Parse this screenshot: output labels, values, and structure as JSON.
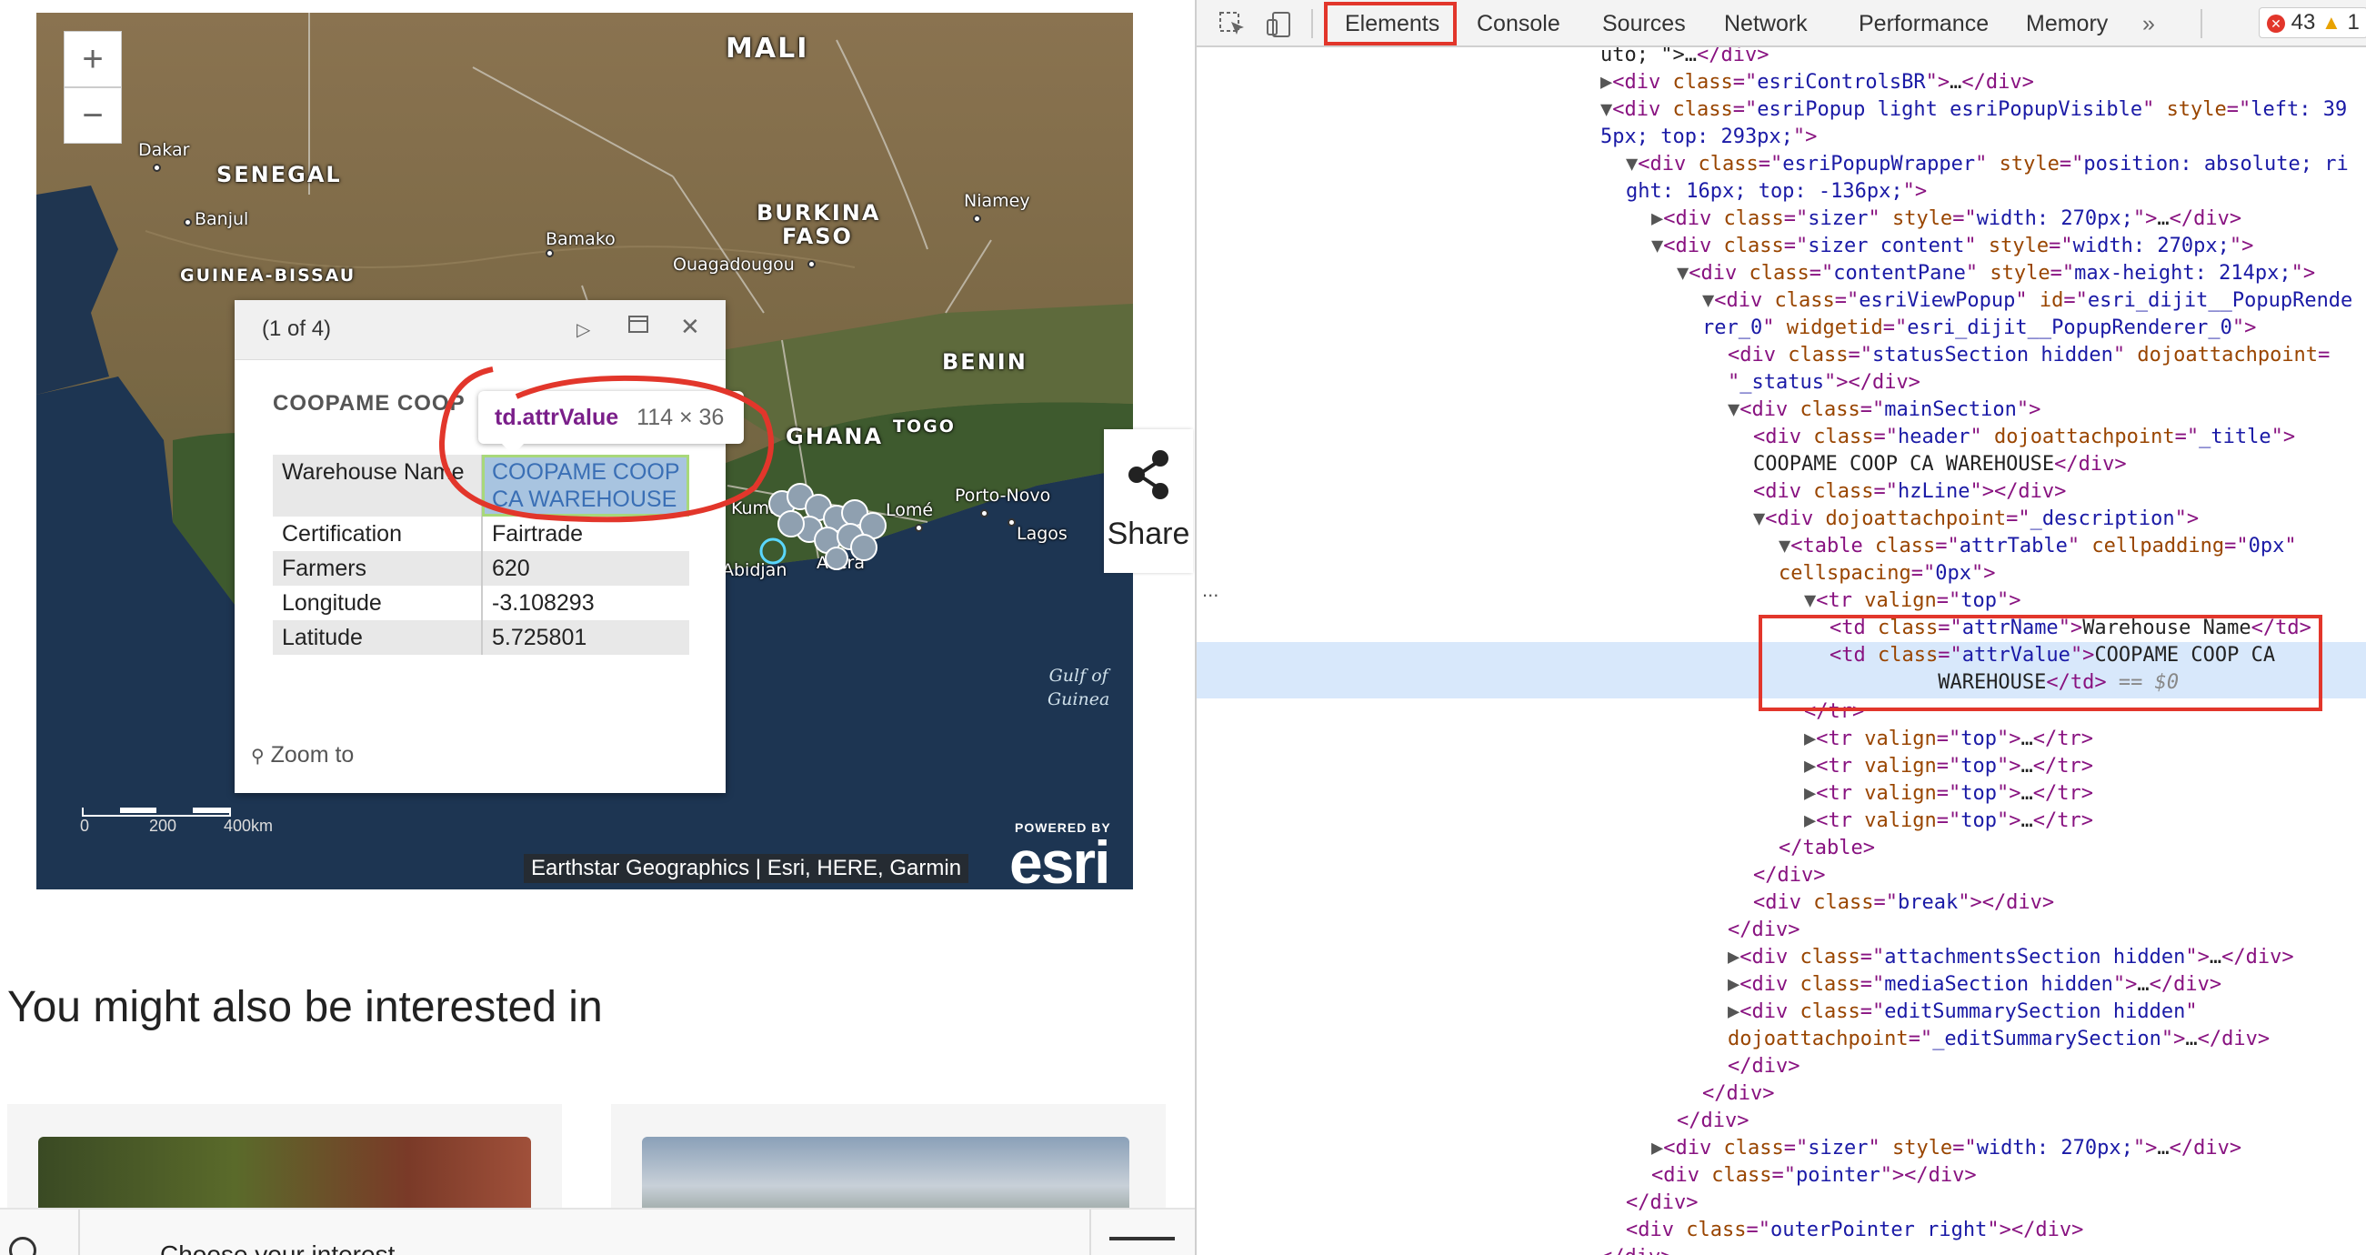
{
  "map": {
    "zoom_in": "+",
    "zoom_out": "−",
    "countries": [
      "MALI",
      "SENEGAL",
      "GUINEA-BISSAU",
      "BURKINA",
      "FASO",
      "BENIN",
      "GHANA",
      "TOGO"
    ],
    "cities": [
      "Dakar",
      "Banjul",
      "Bamako",
      "Niamey",
      "Ouagadougou",
      "Kumasi",
      "Abidjan",
      "Accra",
      "Lomé",
      "Porto-Novo",
      "Lagos"
    ],
    "gulf": [
      "Gulf of",
      "Guinea"
    ],
    "scale": [
      "0",
      "200",
      "400km"
    ],
    "attribution": "Earthstar Geographics | Esri, HERE, Garmin",
    "powered_by": "POWERED BY",
    "esri_logo": "esri"
  },
  "popup": {
    "count": "(1 of 4)",
    "title": "COOPAME COOP",
    "rows": [
      {
        "name": "Warehouse Name",
        "value": "COOPAME COOP CA WAREHOUSE"
      },
      {
        "name": "Certification",
        "value": "Fairtrade"
      },
      {
        "name": "Farmers",
        "value": "620"
      },
      {
        "name": "Longitude",
        "value": "-3.108293"
      },
      {
        "name": "Latitude",
        "value": "5.725801"
      }
    ],
    "zoom_to": "Zoom to"
  },
  "tooltip": {
    "name": "td.attrValue",
    "size": "114 × 36"
  },
  "share": {
    "label": "Share"
  },
  "interest": {
    "title": "You might also be interested in"
  },
  "bottombar": {
    "choose": "Choose your interest"
  },
  "devtools": {
    "tabs": [
      "Elements",
      "Console",
      "Sources",
      "Network",
      "Performance",
      "Memory",
      "»"
    ],
    "errors": "43",
    "warnings": "1",
    "ellipsis": "...",
    "lines": [
      {
        "indent": 0,
        "html": "<span class='tx'>uto; \">…</span><span class='tg'>&lt;/div&gt;</span>"
      },
      {
        "indent": 0,
        "html": "<span class='tri'>▶</span><span class='tg'>&lt;div </span><span class='at'>class</span><span class='tg'>=\"</span><span class='av'>esriControlsBR</span><span class='tg'>\"&gt;</span><span class='tx'>…</span><span class='tg'>&lt;/div&gt;</span>"
      },
      {
        "indent": 0,
        "html": "<span class='tri'>▼</span><span class='tg'>&lt;div </span><span class='at'>class</span><span class='tg'>=\"</span><span class='av'>esriPopup light esriPopupVisible</span><span class='tg'>\" </span><span class='at'>style</span><span class='tg'>=\"</span><span class='av'>left: 39</span>"
      },
      {
        "indent": 0,
        "html": "<span class='av'>5px; top: 293px;</span><span class='tg'>\"&gt;</span>"
      },
      {
        "indent": 1,
        "html": "<span class='tri'>▼</span><span class='tg'>&lt;div </span><span class='at'>class</span><span class='tg'>=\"</span><span class='av'>esriPopupWrapper</span><span class='tg'>\" </span><span class='at'>style</span><span class='tg'>=\"</span><span class='av'>position: absolute; ri</span>"
      },
      {
        "indent": 1,
        "html": "<span class='av'>ght: 16px; top: -136px;</span><span class='tg'>\"&gt;</span>"
      },
      {
        "indent": 2,
        "html": "<span class='tri'>▶</span><span class='tg'>&lt;div </span><span class='at'>class</span><span class='tg'>=\"</span><span class='av'>sizer</span><span class='tg'>\" </span><span class='at'>style</span><span class='tg'>=\"</span><span class='av'>width: 270px;</span><span class='tg'>\"&gt;</span><span class='tx'>…</span><span class='tg'>&lt;/div&gt;</span>"
      },
      {
        "indent": 2,
        "html": "<span class='tri'>▼</span><span class='tg'>&lt;div </span><span class='at'>class</span><span class='tg'>=\"</span><span class='av'>sizer content</span><span class='tg'>\" </span><span class='at'>style</span><span class='tg'>=\"</span><span class='av'>width: 270px;</span><span class='tg'>\"&gt;</span>"
      },
      {
        "indent": 3,
        "html": "<span class='tri'>▼</span><span class='tg'>&lt;div </span><span class='at'>class</span><span class='tg'>=\"</span><span class='av'>contentPane</span><span class='tg'>\" </span><span class='at'>style</span><span class='tg'>=\"</span><span class='av'>max-height: 214px;</span><span class='tg'>\"&gt;</span>"
      },
      {
        "indent": 4,
        "html": "<span class='tri'>▼</span><span class='tg'>&lt;div </span><span class='at'>class</span><span class='tg'>=\"</span><span class='av'>esriViewPopup</span><span class='tg'>\" </span><span class='at'>id</span><span class='tg'>=\"</span><span class='av'>esri_dijit__PopupRende</span>"
      },
      {
        "indent": 4,
        "html": "<span class='av'>rer_0</span><span class='tg'>\" </span><span class='at'>widgetid</span><span class='tg'>=\"</span><span class='av'>esri_dijit__PopupRenderer_0</span><span class='tg'>\"&gt;</span>"
      },
      {
        "indent": 5,
        "html": "<span class='tg'>&lt;div </span><span class='at'>class</span><span class='tg'>=\"</span><span class='av'>statusSection hidden</span><span class='tg'>\" </span><span class='at'>dojoattachpoint</span><span class='tg'>=</span>"
      },
      {
        "indent": 5,
        "html": "<span class='tg'>\"</span><span class='av'>_status</span><span class='tg'>\"&gt;&lt;/div&gt;</span>"
      },
      {
        "indent": 5,
        "html": "<span class='tri'>▼</span><span class='tg'>&lt;div </span><span class='at'>class</span><span class='tg'>=\"</span><span class='av'>mainSection</span><span class='tg'>\"&gt;</span>"
      },
      {
        "indent": 6,
        "html": "<span class='tg'>&lt;div </span><span class='at'>class</span><span class='tg'>=\"</span><span class='av'>header</span><span class='tg'>\" </span><span class='at'>dojoattachpoint</span><span class='tg'>=\"</span><span class='av'>_title</span><span class='tg'>\"&gt;</span>"
      },
      {
        "indent": 6,
        "html": "<span class='tx'>COOPAME COOP CA WAREHOUSE</span><span class='tg'>&lt;/div&gt;</span>"
      },
      {
        "indent": 6,
        "html": "<span class='tg'>&lt;div </span><span class='at'>class</span><span class='tg'>=\"</span><span class='av'>hzLine</span><span class='tg'>\"&gt;&lt;/div&gt;</span>"
      },
      {
        "indent": 6,
        "html": "<span class='tri'>▼</span><span class='tg'>&lt;div </span><span class='at'>dojoattachpoint</span><span class='tg'>=\"</span><span class='av'>_description</span><span class='tg'>\"&gt;</span>"
      },
      {
        "indent": 7,
        "html": "<span class='tri'>▼</span><span class='tg'>&lt;table </span><span class='at'>class</span><span class='tg'>=\"</span><span class='av'>attrTable</span><span class='tg'>\" </span><span class='at'>cellpadding</span><span class='tg'>=\"</span><span class='av'>0px</span><span class='tg'>\"</span>"
      },
      {
        "indent": 7,
        "html": "<span class='at'>cellspacing</span><span class='tg'>=\"</span><span class='av'>0px</span><span class='tg'>\"&gt;</span>"
      },
      {
        "indent": 8,
        "html": "<span class='tri'>▼</span><span class='tg'>&lt;tr </span><span class='at'>valign</span><span class='tg'>=\"</span><span class='av'>top</span><span class='tg'>\"&gt;</span>"
      },
      {
        "indent": 9,
        "html": "<span class='tg'>&lt;td </span><span class='at'>class</span><span class='tg'>=\"</span><span class='av'>attrName</span><span class='tg'>\"&gt;</span><span class='tx'>Warehouse Name</span><span class='tg'>&lt;/td&gt;</span>"
      },
      {
        "indent": 9,
        "sel": true,
        "html": "<span class='tg'>&lt;td </span><span class='at'>class</span><span class='tg'>=\"</span><span class='av'>attrValue</span><span class='tg'>\"&gt;</span><span class='tx'>COOPAME COOP CA</span>\n<span class='tx'>         WAREHOUSE</span><span class='tg'>&lt;/td&gt;</span><span class='dim'> == $0</span>"
      },
      {
        "indent": 8,
        "html": "<span class='tg'>&lt;/tr&gt;</span>"
      },
      {
        "indent": 8,
        "html": "<span class='tri'>▶</span><span class='tg'>&lt;tr </span><span class='at'>valign</span><span class='tg'>=\"</span><span class='av'>top</span><span class='tg'>\"&gt;</span><span class='tx'>…</span><span class='tg'>&lt;/tr&gt;</span>"
      },
      {
        "indent": 8,
        "html": "<span class='tri'>▶</span><span class='tg'>&lt;tr </span><span class='at'>valign</span><span class='tg'>=\"</span><span class='av'>top</span><span class='tg'>\"&gt;</span><span class='tx'>…</span><span class='tg'>&lt;/tr&gt;</span>"
      },
      {
        "indent": 8,
        "html": "<span class='tri'>▶</span><span class='tg'>&lt;tr </span><span class='at'>valign</span><span class='tg'>=\"</span><span class='av'>top</span><span class='tg'>\"&gt;</span><span class='tx'>…</span><span class='tg'>&lt;/tr&gt;</span>"
      },
      {
        "indent": 8,
        "html": "<span class='tri'>▶</span><span class='tg'>&lt;tr </span><span class='at'>valign</span><span class='tg'>=\"</span><span class='av'>top</span><span class='tg'>\"&gt;</span><span class='tx'>…</span><span class='tg'>&lt;/tr&gt;</span>"
      },
      {
        "indent": 7,
        "html": "<span class='tg'>&lt;/table&gt;</span>"
      },
      {
        "indent": 6,
        "html": "<span class='tg'>&lt;/div&gt;</span>"
      },
      {
        "indent": 6,
        "html": "<span class='tg'>&lt;div </span><span class='at'>class</span><span class='tg'>=\"</span><span class='av'>break</span><span class='tg'>\"&gt;&lt;/div&gt;</span>"
      },
      {
        "indent": 5,
        "html": "<span class='tg'>&lt;/div&gt;</span>"
      },
      {
        "indent": 5,
        "html": "<span class='tri'>▶</span><span class='tg'>&lt;div </span><span class='at'>class</span><span class='tg'>=\"</span><span class='av'>attachmentsSection hidden</span><span class='tg'>\"&gt;</span><span class='tx'>…</span><span class='tg'>&lt;/div&gt;</span>"
      },
      {
        "indent": 5,
        "html": "<span class='tri'>▶</span><span class='tg'>&lt;div </span><span class='at'>class</span><span class='tg'>=\"</span><span class='av'>mediaSection hidden</span><span class='tg'>\"&gt;</span><span class='tx'>…</span><span class='tg'>&lt;/div&gt;</span>"
      },
      {
        "indent": 5,
        "html": "<span class='tri'>▶</span><span class='tg'>&lt;div </span><span class='at'>class</span><span class='tg'>=\"</span><span class='av'>editSummarySection hidden</span><span class='tg'>\"</span>"
      },
      {
        "indent": 5,
        "html": "<span class='at'>dojoattachpoint</span><span class='tg'>=\"</span><span class='av'>_editSummarySection</span><span class='tg'>\"&gt;</span><span class='tx'>…</span><span class='tg'>&lt;/div&gt;</span>"
      },
      {
        "indent": 5,
        "html": "<span class='tg'>&lt;/div&gt;</span>"
      },
      {
        "indent": 4,
        "html": "<span class='tg'>&lt;/div&gt;</span>"
      },
      {
        "indent": 3,
        "html": "<span class='tg'>&lt;/div&gt;</span>"
      },
      {
        "indent": 2,
        "html": "<span class='tri'>▶</span><span class='tg'>&lt;div </span><span class='at'>class</span><span class='tg'>=\"</span><span class='av'>sizer</span><span class='tg'>\" </span><span class='at'>style</span><span class='tg'>=\"</span><span class='av'>width: 270px;</span><span class='tg'>\"&gt;</span><span class='tx'>…</span><span class='tg'>&lt;/div&gt;</span>"
      },
      {
        "indent": 2,
        "html": "<span class='tg'>&lt;div </span><span class='at'>class</span><span class='tg'>=\"</span><span class='av'>pointer</span><span class='tg'>\"&gt;&lt;/div&gt;</span>"
      },
      {
        "indent": 1,
        "html": "<span class='tg'>&lt;/div&gt;</span>"
      },
      {
        "indent": 1,
        "html": "<span class='tg'>&lt;div </span><span class='at'>class</span><span class='tg'>=\"</span><span class='av'>outerPointer right</span><span class='tg'>\"&gt;&lt;/div&gt;</span>"
      },
      {
        "indent": 0,
        "html": "<span class='tg'>&lt;/div&gt;</span>"
      }
    ]
  }
}
